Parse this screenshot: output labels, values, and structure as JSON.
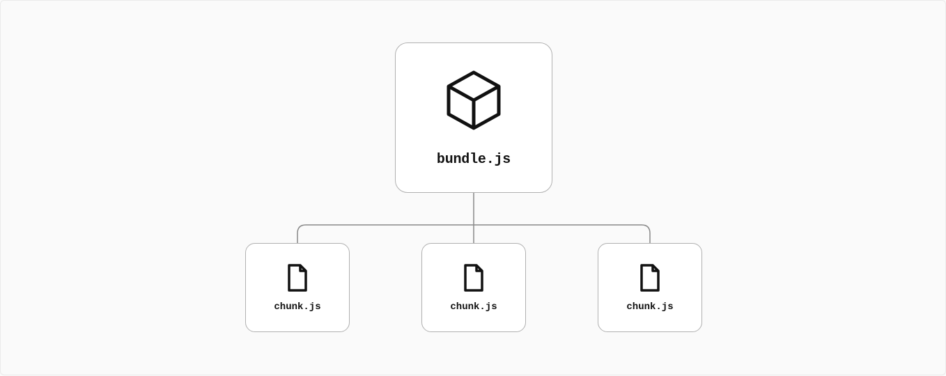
{
  "parent": {
    "label": "bundle.js",
    "icon": "cube-icon"
  },
  "children": [
    {
      "label": "chunk.js",
      "icon": "file-icon"
    },
    {
      "label": "chunk.js",
      "icon": "file-icon"
    },
    {
      "label": "chunk.js",
      "icon": "file-icon"
    }
  ],
  "colors": {
    "bg": "#fafafa",
    "nodeBg": "#ffffff",
    "border": "#b0b0b0",
    "stroke": "#888888",
    "text": "#111111"
  }
}
